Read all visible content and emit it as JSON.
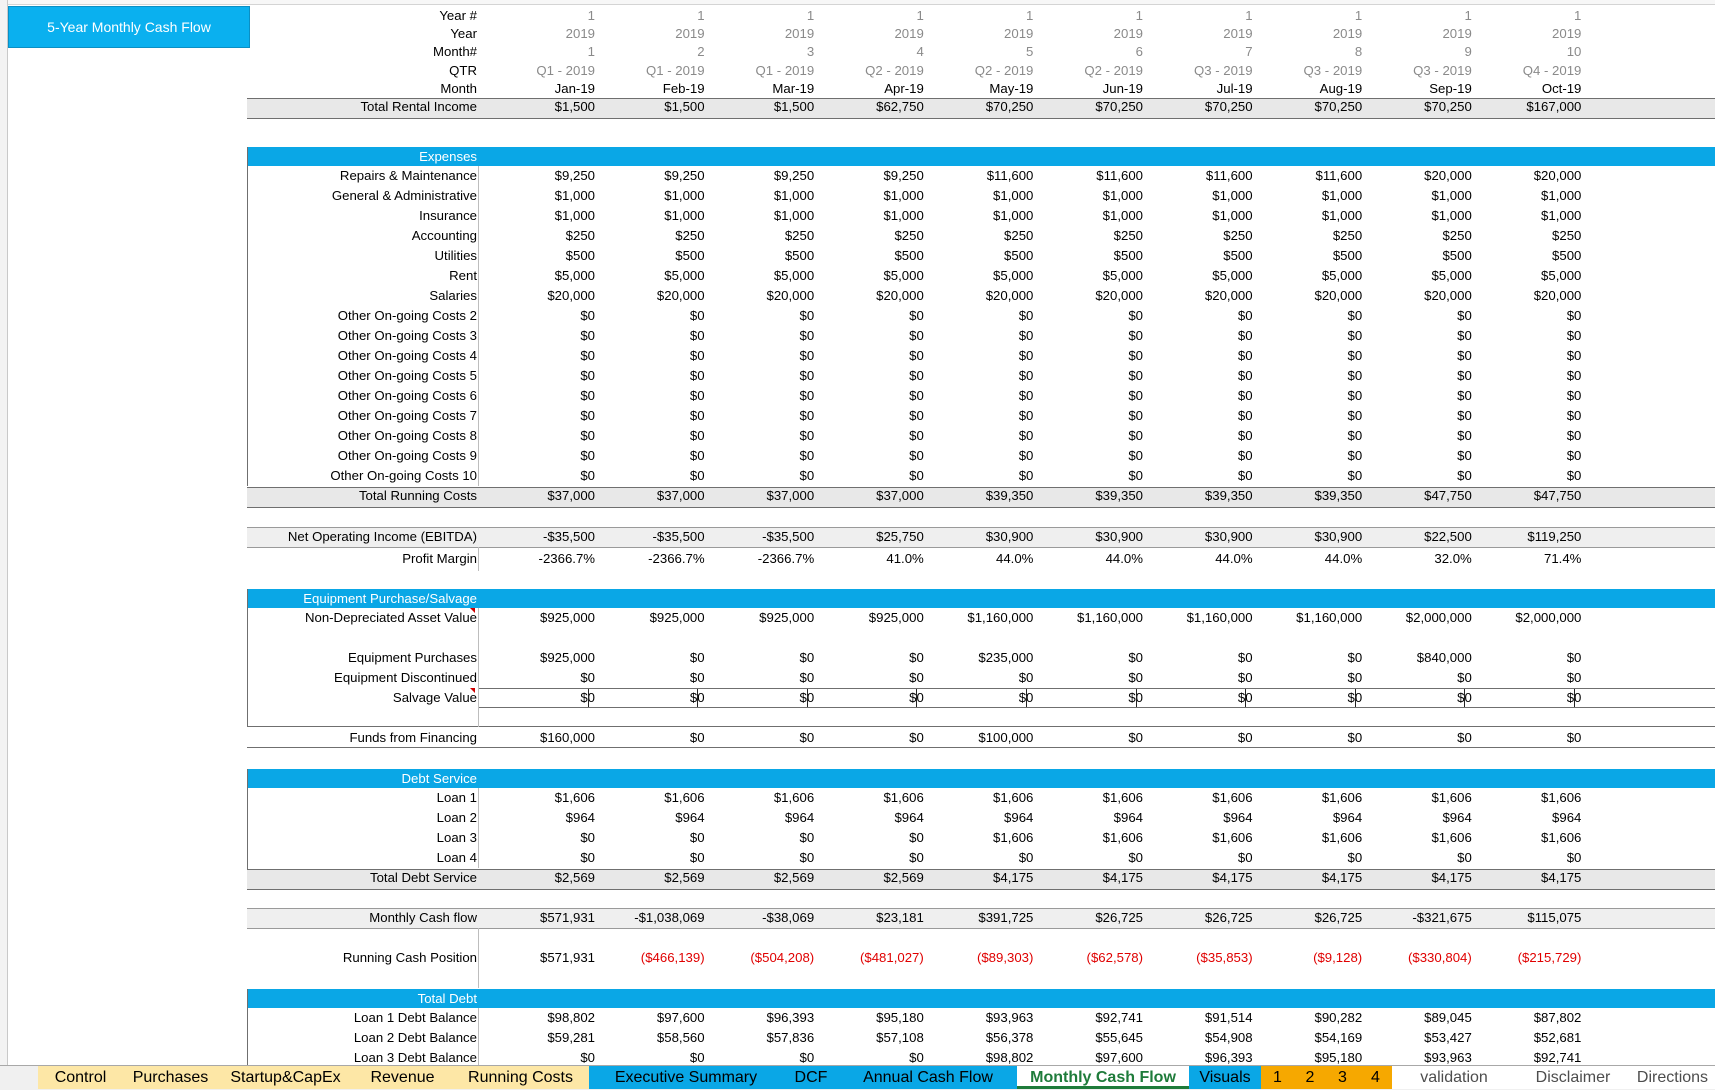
{
  "sheet": {
    "title_box": "5-Year Monthly Cash Flow",
    "header_rows": [
      {
        "label": "Year #",
        "values": [
          "1",
          "1",
          "1",
          "1",
          "1",
          "1",
          "1",
          "1",
          "1",
          "1"
        ]
      },
      {
        "label": "Year",
        "values": [
          "2019",
          "2019",
          "2019",
          "2019",
          "2019",
          "2019",
          "2019",
          "2019",
          "2019",
          "2019"
        ]
      },
      {
        "label": "Month#",
        "values": [
          "1",
          "2",
          "3",
          "4",
          "5",
          "6",
          "7",
          "8",
          "9",
          "10"
        ]
      },
      {
        "label": "QTR",
        "values": [
          "Q1 - 2019",
          "Q1 - 2019",
          "Q1 - 2019",
          "Q2 - 2019",
          "Q2 - 2019",
          "Q2 - 2019",
          "Q3 - 2019",
          "Q3 - 2019",
          "Q3 - 2019",
          "Q4 - 2019"
        ]
      },
      {
        "label": "Month",
        "values": [
          "Jan-19",
          "Feb-19",
          "Mar-19",
          "Apr-19",
          "May-19",
          "Jun-19",
          "Jul-19",
          "Aug-19",
          "Sep-19",
          "Oct-19"
        ]
      }
    ],
    "total_rental_income": {
      "label": "Total Rental Income",
      "values": [
        "$1,500",
        "$1,500",
        "$1,500",
        "$62,750",
        "$70,250",
        "$70,250",
        "$70,250",
        "$70,250",
        "$70,250",
        "$167,000"
      ]
    },
    "expenses": {
      "title": "Expenses",
      "rows": [
        {
          "label": "Repairs & Maintenance",
          "values": [
            "$9,250",
            "$9,250",
            "$9,250",
            "$9,250",
            "$11,600",
            "$11,600",
            "$11,600",
            "$11,600",
            "$20,000",
            "$20,000"
          ]
        },
        {
          "label": "General & Administrative",
          "values": [
            "$1,000",
            "$1,000",
            "$1,000",
            "$1,000",
            "$1,000",
            "$1,000",
            "$1,000",
            "$1,000",
            "$1,000",
            "$1,000"
          ]
        },
        {
          "label": "Insurance",
          "values": [
            "$1,000",
            "$1,000",
            "$1,000",
            "$1,000",
            "$1,000",
            "$1,000",
            "$1,000",
            "$1,000",
            "$1,000",
            "$1,000"
          ]
        },
        {
          "label": "Accounting",
          "values": [
            "$250",
            "$250",
            "$250",
            "$250",
            "$250",
            "$250",
            "$250",
            "$250",
            "$250",
            "$250"
          ]
        },
        {
          "label": "Utilities",
          "values": [
            "$500",
            "$500",
            "$500",
            "$500",
            "$500",
            "$500",
            "$500",
            "$500",
            "$500",
            "$500"
          ]
        },
        {
          "label": "Rent",
          "values": [
            "$5,000",
            "$5,000",
            "$5,000",
            "$5,000",
            "$5,000",
            "$5,000",
            "$5,000",
            "$5,000",
            "$5,000",
            "$5,000"
          ]
        },
        {
          "label": "Salaries",
          "values": [
            "$20,000",
            "$20,000",
            "$20,000",
            "$20,000",
            "$20,000",
            "$20,000",
            "$20,000",
            "$20,000",
            "$20,000",
            "$20,000"
          ]
        },
        {
          "label": "Other On-going Costs 2",
          "values": [
            "$0",
            "$0",
            "$0",
            "$0",
            "$0",
            "$0",
            "$0",
            "$0",
            "$0",
            "$0"
          ]
        },
        {
          "label": "Other On-going Costs 3",
          "values": [
            "$0",
            "$0",
            "$0",
            "$0",
            "$0",
            "$0",
            "$0",
            "$0",
            "$0",
            "$0"
          ]
        },
        {
          "label": "Other On-going Costs 4",
          "values": [
            "$0",
            "$0",
            "$0",
            "$0",
            "$0",
            "$0",
            "$0",
            "$0",
            "$0",
            "$0"
          ]
        },
        {
          "label": "Other On-going Costs 5",
          "values": [
            "$0",
            "$0",
            "$0",
            "$0",
            "$0",
            "$0",
            "$0",
            "$0",
            "$0",
            "$0"
          ]
        },
        {
          "label": "Other On-going Costs 6",
          "values": [
            "$0",
            "$0",
            "$0",
            "$0",
            "$0",
            "$0",
            "$0",
            "$0",
            "$0",
            "$0"
          ]
        },
        {
          "label": "Other On-going Costs 7",
          "values": [
            "$0",
            "$0",
            "$0",
            "$0",
            "$0",
            "$0",
            "$0",
            "$0",
            "$0",
            "$0"
          ]
        },
        {
          "label": "Other On-going Costs 8",
          "values": [
            "$0",
            "$0",
            "$0",
            "$0",
            "$0",
            "$0",
            "$0",
            "$0",
            "$0",
            "$0"
          ]
        },
        {
          "label": "Other On-going Costs 9",
          "values": [
            "$0",
            "$0",
            "$0",
            "$0",
            "$0",
            "$0",
            "$0",
            "$0",
            "$0",
            "$0"
          ]
        },
        {
          "label": "Other On-going Costs 10",
          "values": [
            "$0",
            "$0",
            "$0",
            "$0",
            "$0",
            "$0",
            "$0",
            "$0",
            "$0",
            "$0"
          ]
        }
      ],
      "total": {
        "label": "Total Running Costs",
        "values": [
          "$37,000",
          "$37,000",
          "$37,000",
          "$37,000",
          "$39,350",
          "$39,350",
          "$39,350",
          "$39,350",
          "$47,750",
          "$47,750"
        ]
      }
    },
    "ebitda": {
      "label": "Net Operating Income (EBITDA)",
      "values": [
        "-$35,500",
        "-$35,500",
        "-$35,500",
        "$25,750",
        "$30,900",
        "$30,900",
        "$30,900",
        "$30,900",
        "$22,500",
        "$119,250"
      ]
    },
    "profit_margin": {
      "label": "Profit Margin",
      "values": [
        "-2366.7%",
        "-2366.7%",
        "-2366.7%",
        "41.0%",
        "44.0%",
        "44.0%",
        "44.0%",
        "44.0%",
        "32.0%",
        "71.4%"
      ]
    },
    "equipment": {
      "title": "Equipment Purchase/Salvage",
      "asset_value": {
        "label": "Non-Depreciated Asset Value",
        "values": [
          "$925,000",
          "$925,000",
          "$925,000",
          "$925,000",
          "$1,160,000",
          "$1,160,000",
          "$1,160,000",
          "$1,160,000",
          "$2,000,000",
          "$2,000,000"
        ]
      },
      "purchases": {
        "label": "Equipment Purchases",
        "values": [
          "$925,000",
          "$0",
          "$0",
          "$0",
          "$235,000",
          "$0",
          "$0",
          "$0",
          "$840,000",
          "$0"
        ]
      },
      "discontinued": {
        "label": "Equipment Discontinued",
        "values": [
          "$0",
          "$0",
          "$0",
          "$0",
          "$0",
          "$0",
          "$0",
          "$0",
          "$0",
          "$0"
        ]
      },
      "salvage": {
        "label": "Salvage Value",
        "values": [
          "$0",
          "$0",
          "$0",
          "$0",
          "$0",
          "$0",
          "$0",
          "$0",
          "$0",
          "$0"
        ]
      }
    },
    "financing": {
      "label": "Funds from Financing",
      "values": [
        "$160,000",
        "$0",
        "$0",
        "$0",
        "$100,000",
        "$0",
        "$0",
        "$0",
        "$0",
        "$0"
      ]
    },
    "debt_service": {
      "title": "Debt Service",
      "rows": [
        {
          "label": "Loan 1",
          "values": [
            "$1,606",
            "$1,606",
            "$1,606",
            "$1,606",
            "$1,606",
            "$1,606",
            "$1,606",
            "$1,606",
            "$1,606",
            "$1,606"
          ]
        },
        {
          "label": "Loan 2",
          "values": [
            "$964",
            "$964",
            "$964",
            "$964",
            "$964",
            "$964",
            "$964",
            "$964",
            "$964",
            "$964"
          ]
        },
        {
          "label": "Loan 3",
          "values": [
            "$0",
            "$0",
            "$0",
            "$0",
            "$1,606",
            "$1,606",
            "$1,606",
            "$1,606",
            "$1,606",
            "$1,606"
          ]
        },
        {
          "label": "Loan 4",
          "values": [
            "$0",
            "$0",
            "$0",
            "$0",
            "$0",
            "$0",
            "$0",
            "$0",
            "$0",
            "$0"
          ]
        }
      ],
      "total": {
        "label": "Total Debt Service",
        "values": [
          "$2,569",
          "$2,569",
          "$2,569",
          "$2,569",
          "$4,175",
          "$4,175",
          "$4,175",
          "$4,175",
          "$4,175",
          "$4,175"
        ]
      }
    },
    "monthly_cash_flow": {
      "label": "Monthly Cash flow",
      "values": [
        "$571,931",
        "-$1,038,069",
        "-$38,069",
        "$23,181",
        "$391,725",
        "$26,725",
        "$26,725",
        "$26,725",
        "-$321,675",
        "$115,075"
      ]
    },
    "running_cash": {
      "label": "Running Cash Position",
      "values": [
        "$571,931",
        "($466,139)",
        "($504,208)",
        "($481,027)",
        "($89,303)",
        "($62,578)",
        "($35,853)",
        "($9,128)",
        "($330,804)",
        "($215,729)"
      ]
    },
    "total_debt": {
      "title": "Total Debt",
      "rows": [
        {
          "label": "Loan 1 Debt Balance",
          "values": [
            "$98,802",
            "$97,600",
            "$96,393",
            "$95,180",
            "$93,963",
            "$92,741",
            "$91,514",
            "$90,282",
            "$89,045",
            "$87,802"
          ]
        },
        {
          "label": "Loan 2 Debt Balance",
          "values": [
            "$59,281",
            "$58,560",
            "$57,836",
            "$57,108",
            "$56,378",
            "$55,645",
            "$54,908",
            "$54,169",
            "$53,427",
            "$52,681"
          ]
        },
        {
          "label": "Loan 3 Debt Balance",
          "values": [
            "$0",
            "$0",
            "$0",
            "$0",
            "$98,802",
            "$97,600",
            "$96,393",
            "$95,180",
            "$93,963",
            "$92,741"
          ]
        }
      ]
    }
  },
  "tabs": [
    {
      "label": "Control",
      "style": "yellow"
    },
    {
      "label": "Purchases",
      "style": "yellow"
    },
    {
      "label": "Startup&CapEx",
      "style": "yellow"
    },
    {
      "label": "Revenue",
      "style": "yellow"
    },
    {
      "label": "Running Costs",
      "style": "yellow"
    },
    {
      "label": "Executive Summary",
      "style": "blue"
    },
    {
      "label": "DCF",
      "style": "blue"
    },
    {
      "label": "Annual Cash Flow",
      "style": "blue"
    },
    {
      "label": "Monthly Cash Flow",
      "style": "active"
    },
    {
      "label": "Visuals",
      "style": "blue"
    },
    {
      "label": "1",
      "style": "orange"
    },
    {
      "label": "2",
      "style": "orange"
    },
    {
      "label": "3",
      "style": "orange"
    },
    {
      "label": "4",
      "style": "orange"
    },
    {
      "label": "validation",
      "style": "plain"
    },
    {
      "label": "Disclaimer",
      "style": "plain"
    },
    {
      "label": "Directions",
      "style": "plain"
    }
  ],
  "colors": {
    "section_blue": "#0aa7e6",
    "title_blue": "#0ab0ef",
    "negative_red": "#e00000",
    "active_tab_green": "#1e7b3a",
    "input_tab_yellow": "#fde7a6",
    "number_tab_orange": "#f6a800"
  }
}
